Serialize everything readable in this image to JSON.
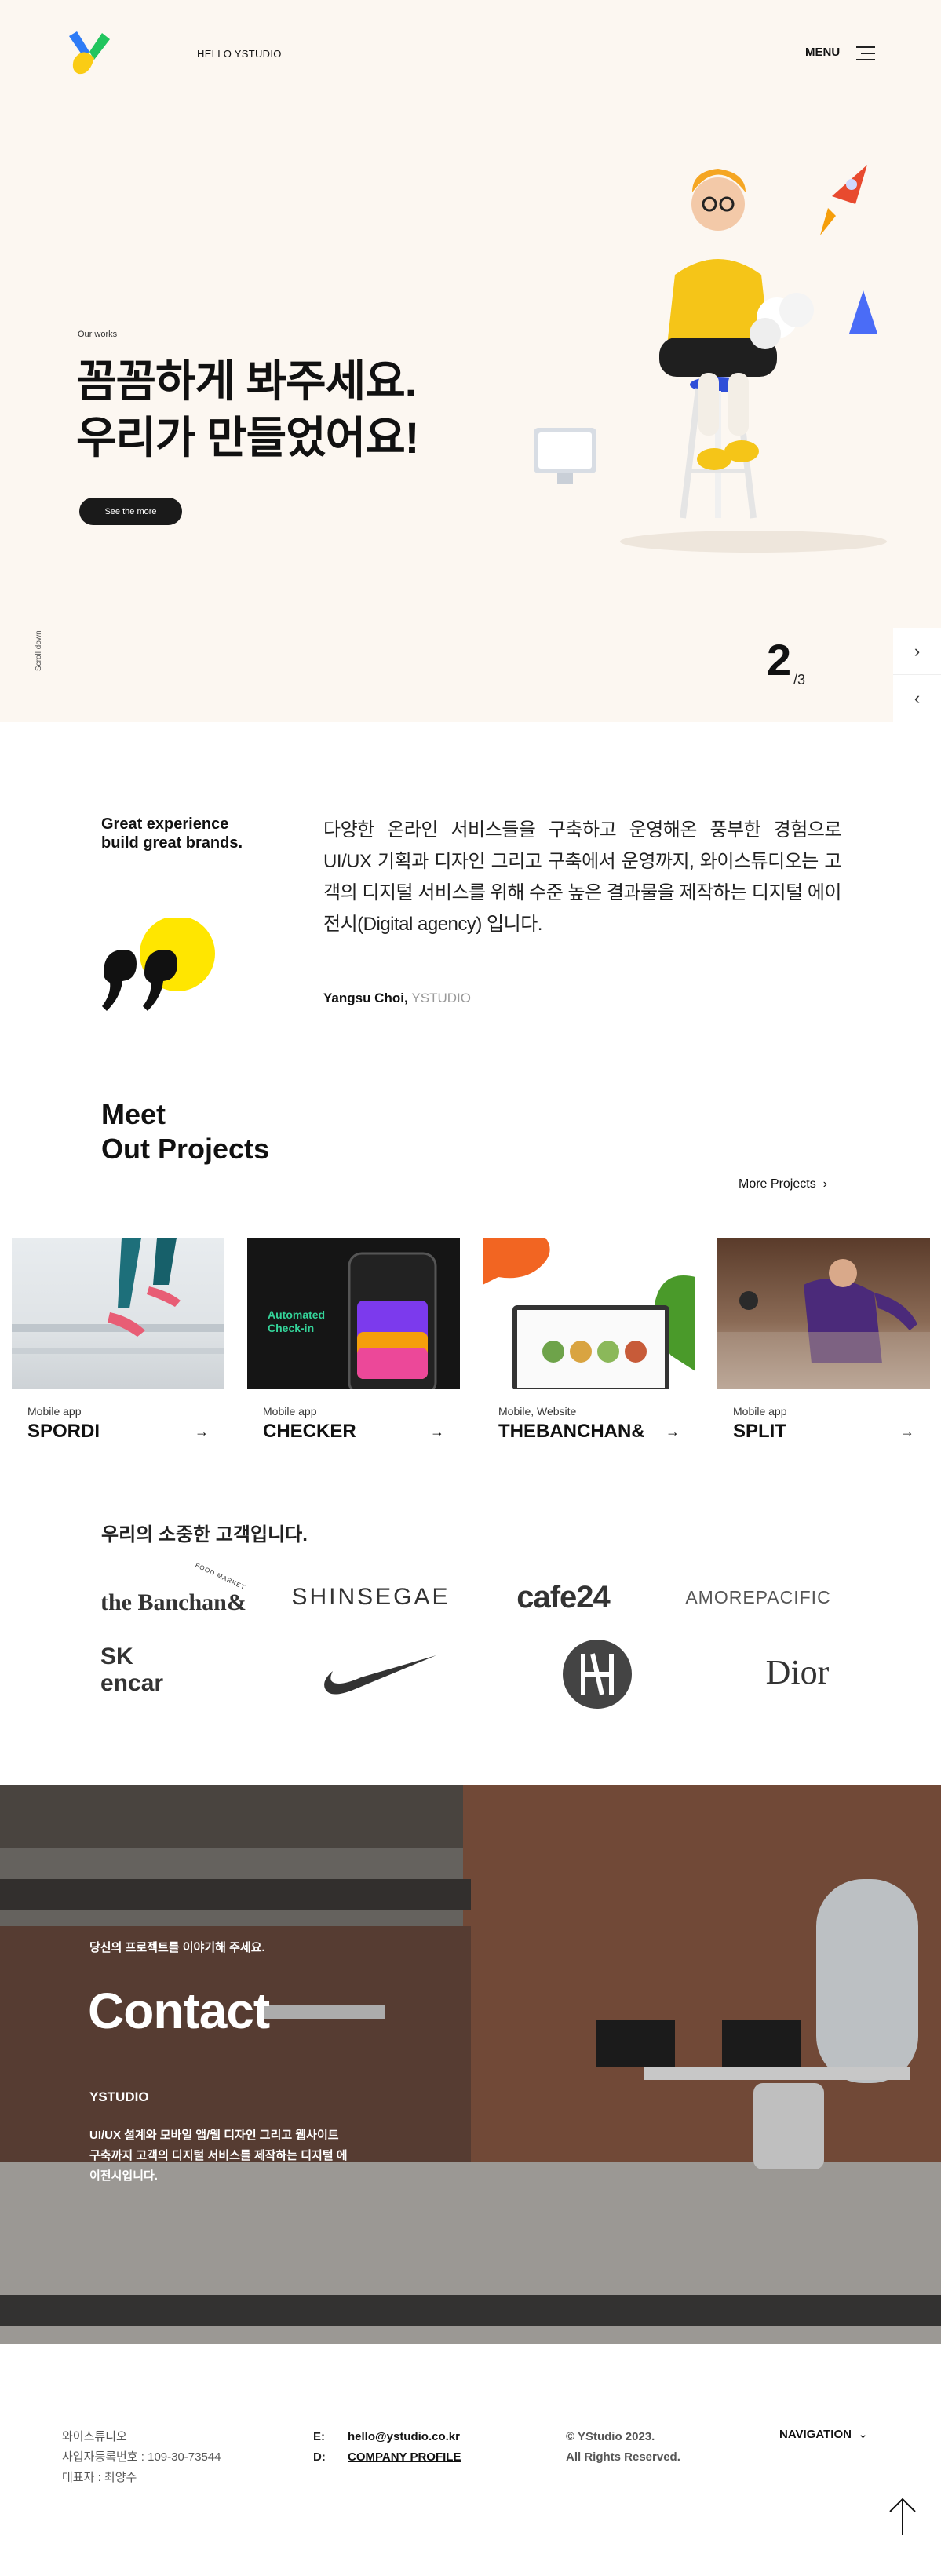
{
  "header": {
    "hello": "HELLO YSTUDIO",
    "menu": "MENU"
  },
  "hero": {
    "eyebrow": "Our works",
    "title_line1": "꼼꼼하게 봐주세요.",
    "title_line2": "우리가 만들었어요!",
    "cta": "See the more",
    "scroll": "Scroll down",
    "slide_current": "2",
    "slide_total": "/3"
  },
  "about": {
    "tagline_line1": "Great experience",
    "tagline_line2": "build great brands.",
    "text": "다양한 온라인 서비스들을 구축하고 운영해온 풍부한 경험으로 UI/UX 기획과 디자인 그리고 구축에서 운영까지, 와이스튜디오는 고객의 디지털 서비스를 위해 수준 높은 결과물을 제작하는 디지털 에이전시(Digital agency) 입니다.",
    "sig_name": "Yangsu Choi,",
    "sig_company": "YSTUDIO"
  },
  "projects": {
    "title_line1": "Meet",
    "title_line2": "Out Projects",
    "more": "More Projects",
    "items": [
      {
        "type": "Mobile app",
        "name": "SPORDI"
      },
      {
        "type": "Mobile app",
        "name": "CHECKER"
      },
      {
        "type": "Mobile, Website",
        "name": "THEBANCHAN&"
      },
      {
        "type": "Mobile app",
        "name": "SPLIT"
      }
    ],
    "checker_text": "Automated Check-in"
  },
  "clients": {
    "title": "우리의 소중한 고객입니다.",
    "logos": [
      "the Banchan&",
      "SHINSEGAE",
      "cafe24",
      "AMOREPACIFIC",
      "SK encar",
      "Nike",
      "Hyundai",
      "Dior"
    ],
    "banchan_tag": "FOOD MARKET"
  },
  "contact": {
    "sub": "당신의 프로젝트를 이야기해 주세요.",
    "title": "Contact",
    "name": "YSTUDIO",
    "desc": "UI/UX 설계와 모바일 앱/웹 디자인 그리고 웹사이트 구축까지 고객의 디지털 서비스를 제작하는 디지털 에이전시입니다."
  },
  "footer": {
    "company": "와이스튜디오",
    "biznum": "사업자등록번호 : 109-30-73544",
    "ceo": "대표자 : 최양수",
    "email_label": "E:",
    "email": "hello@ystudio.co.kr",
    "doc_label": "D:",
    "doc": "COMPANY PROFILE",
    "copy1": "© YStudio 2023.",
    "copy2": "All Rights Reserved.",
    "nav": "NAVIGATION"
  }
}
